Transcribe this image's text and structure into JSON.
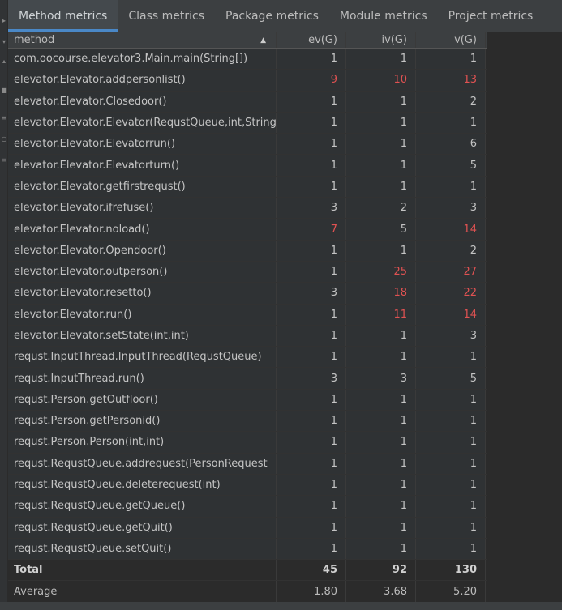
{
  "tabs": [
    {
      "label": "Method metrics",
      "active": true
    },
    {
      "label": "Class metrics",
      "active": false
    },
    {
      "label": "Package metrics",
      "active": false
    },
    {
      "label": "Module metrics",
      "active": false
    },
    {
      "label": "Project metrics",
      "active": false
    }
  ],
  "table": {
    "columns": [
      "method",
      "ev(G)",
      "iv(G)",
      "v(G)"
    ],
    "sort_indicator": "▲",
    "rows": [
      {
        "method": "com.oocourse.elevator3.Main.main(String[])",
        "ev": "1",
        "iv": "1",
        "v": "1",
        "red": [
          false,
          false,
          false
        ]
      },
      {
        "method": "elevator.Elevator.addpersonlist()",
        "ev": "9",
        "iv": "10",
        "v": "13",
        "red": [
          true,
          true,
          true
        ]
      },
      {
        "method": "elevator.Elevator.Closedoor()",
        "ev": "1",
        "iv": "1",
        "v": "2",
        "red": [
          false,
          false,
          false
        ]
      },
      {
        "method": "elevator.Elevator.Elevator(RequstQueue,int,String",
        "ev": "1",
        "iv": "1",
        "v": "1",
        "red": [
          false,
          false,
          false
        ]
      },
      {
        "method": "elevator.Elevator.Elevatorrun()",
        "ev": "1",
        "iv": "1",
        "v": "6",
        "red": [
          false,
          false,
          false
        ]
      },
      {
        "method": "elevator.Elevator.Elevatorturn()",
        "ev": "1",
        "iv": "1",
        "v": "5",
        "red": [
          false,
          false,
          false
        ]
      },
      {
        "method": "elevator.Elevator.getfirstrequst()",
        "ev": "1",
        "iv": "1",
        "v": "1",
        "red": [
          false,
          false,
          false
        ]
      },
      {
        "method": "elevator.Elevator.ifrefuse()",
        "ev": "3",
        "iv": "2",
        "v": "3",
        "red": [
          false,
          false,
          false
        ]
      },
      {
        "method": "elevator.Elevator.noload()",
        "ev": "7",
        "iv": "5",
        "v": "14",
        "red": [
          true,
          false,
          true
        ]
      },
      {
        "method": "elevator.Elevator.Opendoor()",
        "ev": "1",
        "iv": "1",
        "v": "2",
        "red": [
          false,
          false,
          false
        ]
      },
      {
        "method": "elevator.Elevator.outperson()",
        "ev": "1",
        "iv": "25",
        "v": "27",
        "red": [
          false,
          true,
          true
        ]
      },
      {
        "method": "elevator.Elevator.resetto()",
        "ev": "3",
        "iv": "18",
        "v": "22",
        "red": [
          false,
          true,
          true
        ]
      },
      {
        "method": "elevator.Elevator.run()",
        "ev": "1",
        "iv": "11",
        "v": "14",
        "red": [
          false,
          true,
          true
        ]
      },
      {
        "method": "elevator.Elevator.setState(int,int)",
        "ev": "1",
        "iv": "1",
        "v": "3",
        "red": [
          false,
          false,
          false
        ]
      },
      {
        "method": "requst.InputThread.InputThread(RequstQueue)",
        "ev": "1",
        "iv": "1",
        "v": "1",
        "red": [
          false,
          false,
          false
        ]
      },
      {
        "method": "requst.InputThread.run()",
        "ev": "3",
        "iv": "3",
        "v": "5",
        "red": [
          false,
          false,
          false
        ]
      },
      {
        "method": "requst.Person.getOutfloor()",
        "ev": "1",
        "iv": "1",
        "v": "1",
        "red": [
          false,
          false,
          false
        ]
      },
      {
        "method": "requst.Person.getPersonid()",
        "ev": "1",
        "iv": "1",
        "v": "1",
        "red": [
          false,
          false,
          false
        ]
      },
      {
        "method": "requst.Person.Person(int,int)",
        "ev": "1",
        "iv": "1",
        "v": "1",
        "red": [
          false,
          false,
          false
        ]
      },
      {
        "method": "requst.RequstQueue.addrequest(PersonRequest",
        "ev": "1",
        "iv": "1",
        "v": "1",
        "red": [
          false,
          false,
          false
        ]
      },
      {
        "method": "requst.RequstQueue.deleterequest(int)",
        "ev": "1",
        "iv": "1",
        "v": "1",
        "red": [
          false,
          false,
          false
        ]
      },
      {
        "method": "requst.RequstQueue.getQueue()",
        "ev": "1",
        "iv": "1",
        "v": "1",
        "red": [
          false,
          false,
          false
        ]
      },
      {
        "method": "requst.RequstQueue.getQuit()",
        "ev": "1",
        "iv": "1",
        "v": "1",
        "red": [
          false,
          false,
          false
        ]
      },
      {
        "method": "requst.RequstQueue.setQuit()",
        "ev": "1",
        "iv": "1",
        "v": "1",
        "red": [
          false,
          false,
          false
        ]
      }
    ],
    "total": {
      "label": "Total",
      "ev": "45",
      "iv": "92",
      "v": "130"
    },
    "average": {
      "label": "Average",
      "ev": "1.80",
      "iv": "3.68",
      "v": "5.20"
    }
  },
  "colors": {
    "highlight_red": "#e05252",
    "accent_tab": "#4a88c7"
  }
}
